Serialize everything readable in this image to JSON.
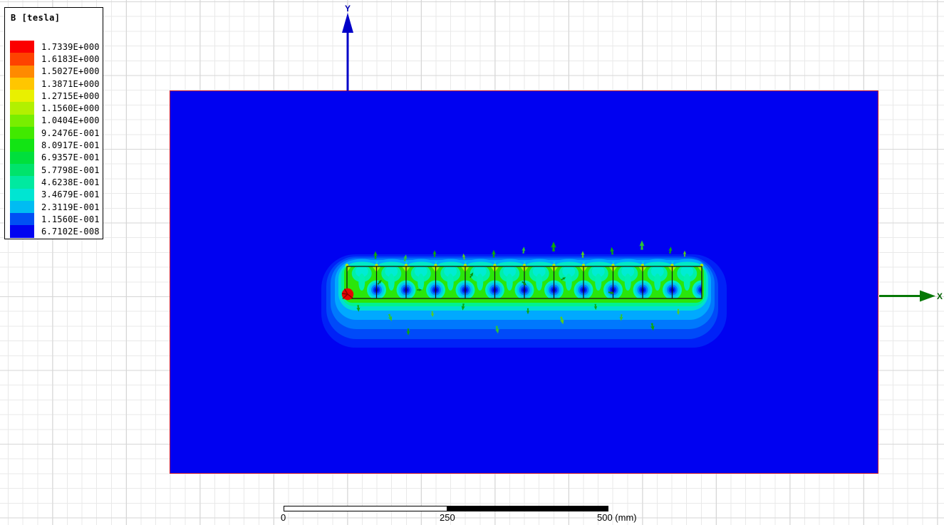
{
  "legend": {
    "title": "B [tesla]",
    "entries": [
      {
        "value": "1.7339E+000",
        "color": "#fb0000"
      },
      {
        "value": "1.6183E+000",
        "color": "#fe4200"
      },
      {
        "value": "1.5027E+000",
        "color": "#ff8a00"
      },
      {
        "value": "1.3871E+000",
        "color": "#ffc600"
      },
      {
        "value": "1.2715E+000",
        "color": "#e9f000"
      },
      {
        "value": "1.1560E+000",
        "color": "#b2f000"
      },
      {
        "value": "1.0404E+000",
        "color": "#78ee00"
      },
      {
        "value": "9.2476E-001",
        "color": "#41e900"
      },
      {
        "value": "8.0917E-001",
        "color": "#12e414"
      },
      {
        "value": "6.9357E-001",
        "color": "#00df3c"
      },
      {
        "value": "5.7798E-001",
        "color": "#00e36b"
      },
      {
        "value": "4.6238E-001",
        "color": "#00e9a0"
      },
      {
        "value": "3.4679E-001",
        "color": "#00e5d2"
      },
      {
        "value": "2.3119E-001",
        "color": "#00bcf2"
      },
      {
        "value": "1.1560E-001",
        "color": "#0050f4"
      },
      {
        "value": "6.7102E-008",
        "color": "#0003f0"
      }
    ]
  },
  "axes": {
    "y_label": "Y",
    "x_label": "X"
  },
  "scale_bar": {
    "tick_start": "0",
    "tick_mid": "250",
    "tick_end": "500 (mm)"
  }
}
